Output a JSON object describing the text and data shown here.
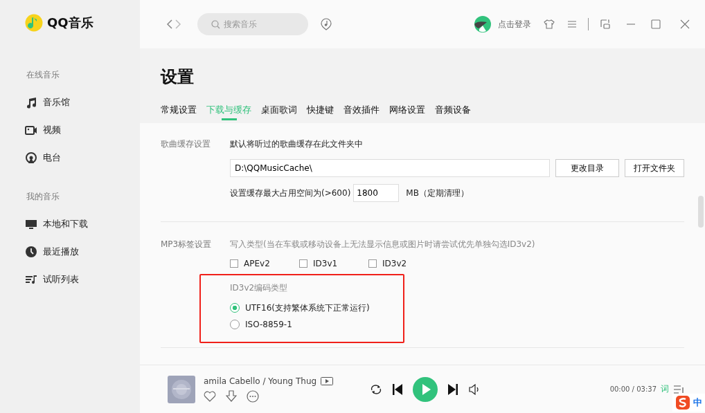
{
  "app": {
    "name": "QQ音乐"
  },
  "sidebar": {
    "sections": [
      {
        "title": "在线音乐",
        "items": [
          {
            "label": "音乐馆",
            "kind": "note",
            "selected": false
          },
          {
            "label": "视频",
            "kind": "video",
            "selected": false
          },
          {
            "label": "电台",
            "kind": "radio",
            "selected": false
          }
        ]
      },
      {
        "title": "我的音乐",
        "items": [
          {
            "label": "本地和下载",
            "kind": "monitor",
            "selected": false
          },
          {
            "label": "最近播放",
            "kind": "clock",
            "selected": false
          },
          {
            "label": "试听列表",
            "kind": "list",
            "selected": false
          }
        ]
      }
    ]
  },
  "top_bar": {
    "search": {
      "placeholder": "搜索音乐"
    },
    "login": "点击登录"
  },
  "page": {
    "title": "设置",
    "tabs": [
      {
        "label": "常规设置",
        "selected": false
      },
      {
        "label": "下载与缓存",
        "selected": true
      },
      {
        "label": "桌面歌词",
        "selected": false
      },
      {
        "label": "快捷键",
        "selected": false
      },
      {
        "label": "音效插件",
        "selected": false
      },
      {
        "label": "网络设置",
        "selected": false
      },
      {
        "label": "音频设备",
        "selected": false
      }
    ]
  },
  "cache": {
    "label": "歌曲缓存设置",
    "description": "默认将听过的歌曲缓存在此文件夹中",
    "path": "D:\\QQMusicCache\\",
    "buttons": [
      "更改目录",
      "打开文件夹"
    ],
    "limit_prefix": "设置缓存最大占用空间为(>600)",
    "limit_value": "1800",
    "limit_unit": "MB（定期清理）"
  },
  "mp3": {
    "label": "MP3标签设置",
    "description": "写入类型(当在车载或移动设备上无法显示信息或图片时请尝试优先单独勾选ID3v2)",
    "checkboxes": [
      {
        "label": "APEv2",
        "checked": false
      },
      {
        "label": "ID3v1",
        "checked": false
      },
      {
        "label": "ID3v2",
        "checked": false
      }
    ],
    "encoding": {
      "title": "ID3v2编码类型",
      "highlighted": true,
      "options": [
        {
          "label": "UTF16(支持繁体系统下正常运行)",
          "selected": true
        },
        {
          "label": "ISO-8859-1",
          "selected": false
        }
      ]
    }
  },
  "player": {
    "track": "amila Cabello / Young Thug",
    "time": "00:00 / 03:37",
    "lyrics": "词"
  },
  "ime": {
    "label": "中"
  }
}
